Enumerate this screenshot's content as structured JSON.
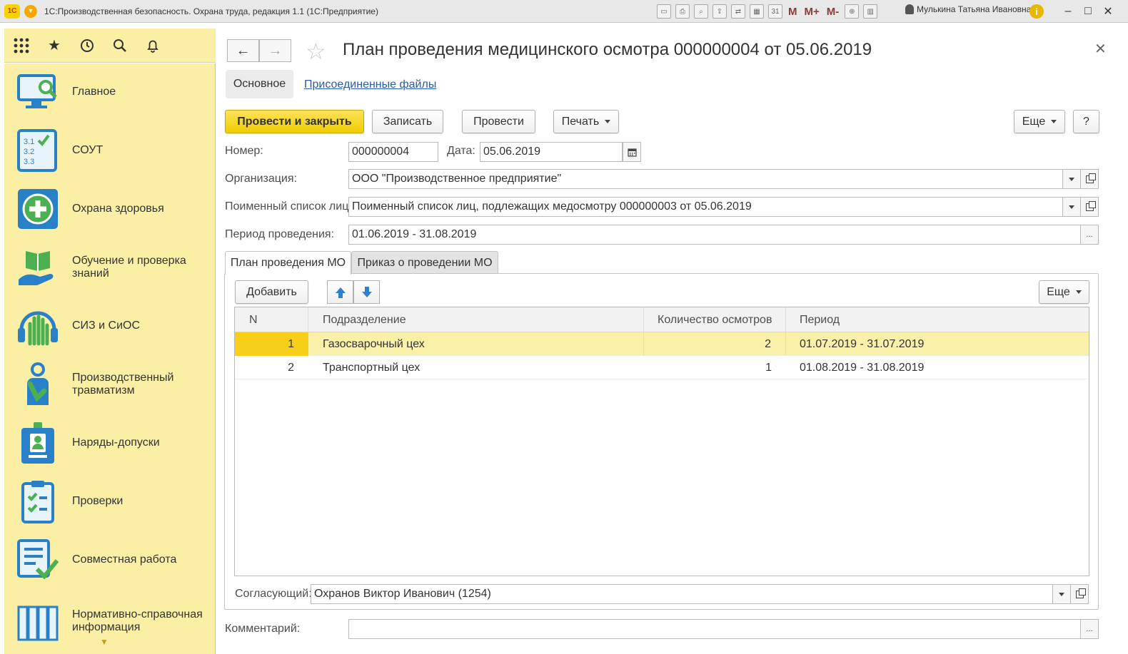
{
  "window": {
    "logo": "1С",
    "title": "1С:Производственная безопасность. Охрана труда, редакция 1.1  (1С:Предприятие)",
    "user": "Мулькина Татьяна Ивановна",
    "mem_buttons": [
      "M",
      "M+",
      "M-"
    ]
  },
  "sidebar": {
    "items": [
      {
        "label": "Главное",
        "icon": "monitor-search-icon"
      },
      {
        "label": "СОУТ",
        "icon": "checklist-icon"
      },
      {
        "label": "Охрана здоровья",
        "icon": "medical-cross-icon"
      },
      {
        "label": "Обучение и проверка знаний",
        "icon": "book-hand-icon"
      },
      {
        "label": "СИЗ и СиОС",
        "icon": "gloves-headphones-icon"
      },
      {
        "label": "Производственный травматизм",
        "icon": "injured-person-icon"
      },
      {
        "label": "Наряды-допуски",
        "icon": "badge-icon"
      },
      {
        "label": "Проверки",
        "icon": "clipboard-check-icon"
      },
      {
        "label": "Совместная работа",
        "icon": "document-check-icon"
      },
      {
        "label": "Нормативно-справочная информация",
        "icon": "books-icon"
      }
    ]
  },
  "document": {
    "title": "План проведения медицинского осмотра 000000004 от 05.06.2019",
    "tabs": {
      "main": "Основное",
      "files": "Присоединенные файлы"
    },
    "toolbar": {
      "post_close": "Провести и закрыть",
      "save": "Записать",
      "post": "Провести",
      "print": "Печать",
      "more": "Еще",
      "help": "?"
    },
    "fields": {
      "number_label": "Номер:",
      "number": "000000004",
      "date_label": "Дата:",
      "date": "05.06.2019",
      "org_label": "Организация:",
      "org": "ООО \"Производственное предприятие\"",
      "list_label": "Поименный список лиц:",
      "list": "Поименный список лиц, подлежащих медосмотру 000000003 от 05.06.2019",
      "period_label": "Период проведения:",
      "period": "01.06.2019 - 31.08.2019",
      "approver_label": "Согласующий:",
      "approver": "Охранов Виктор Иванович (1254)",
      "comment_label": "Комментарий:",
      "comment": "",
      "choose_btn": "..."
    },
    "pane_tabs": [
      "План проведения МО",
      "Приказ о проведении МО"
    ],
    "table_toolbar": {
      "add": "Добавить",
      "more": "Еще"
    },
    "table": {
      "columns": [
        "N",
        "Подразделение",
        "Количество осмотров",
        "Период"
      ],
      "rows": [
        {
          "n": "1",
          "dept": "Газосварочный цех",
          "count": "2",
          "period": "01.07.2019 - 31.07.2019",
          "selected": true
        },
        {
          "n": "2",
          "dept": "Транспортный цех",
          "count": "1",
          "period": "01.08.2019 - 31.08.2019",
          "selected": false
        }
      ]
    }
  },
  "colors": {
    "sidebar_bg": "#fbefa6",
    "primary_button": "#f1cd00",
    "selected_row": "#fbf0a9",
    "icon_blue": "#2a7fc9",
    "icon_green": "#4caf50"
  }
}
